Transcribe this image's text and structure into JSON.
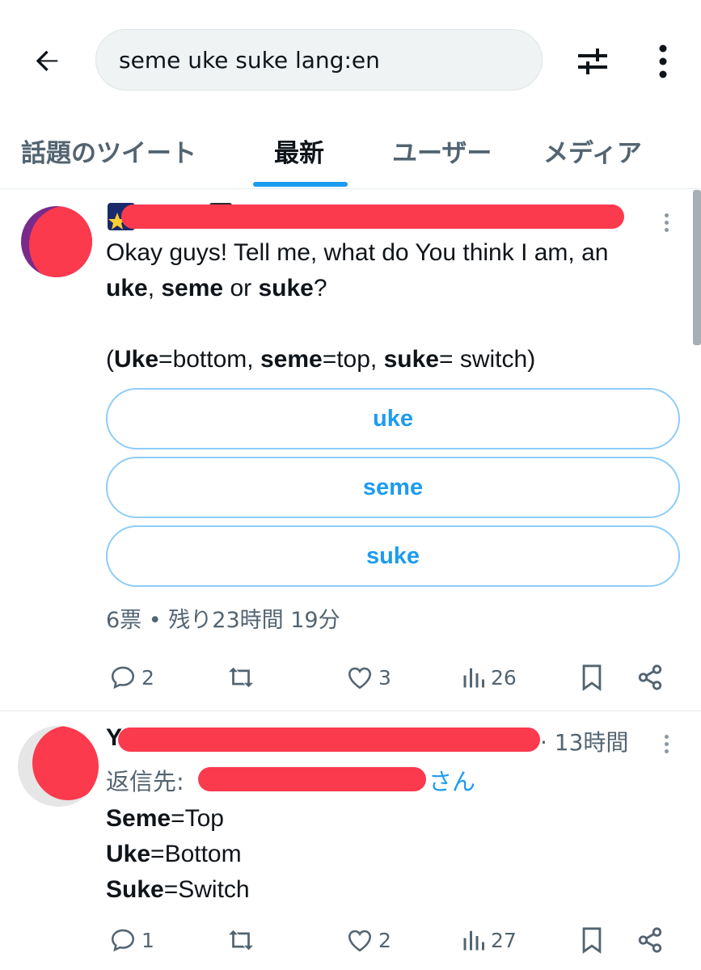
{
  "search": {
    "query": "seme uke suke  lang:en"
  },
  "tabs": [
    {
      "label": "話題のツイート"
    },
    {
      "label": "最新"
    },
    {
      "label": "ユーザー"
    },
    {
      "label": "メディア"
    }
  ],
  "tweet1": {
    "text_line1": "Okay guys! Tell me, what do You think I am, an",
    "line2": [
      {
        "t": "uke",
        "b": true
      },
      {
        "t": ", ",
        "b": false
      },
      {
        "t": "seme",
        "b": true
      },
      {
        "t": " or ",
        "b": false
      },
      {
        "t": "suke",
        "b": true
      },
      {
        "t": "?",
        "b": false
      }
    ],
    "line3": [
      {
        "t": "(",
        "b": false
      },
      {
        "t": "Uke",
        "b": true
      },
      {
        "t": "=bottom, ",
        "b": false
      },
      {
        "t": "seme",
        "b": true
      },
      {
        "t": "=top, ",
        "b": false
      },
      {
        "t": "suke",
        "b": true
      },
      {
        "t": "= switch)",
        "b": false
      }
    ],
    "poll": {
      "options": [
        "uke",
        "seme",
        "suke"
      ],
      "meta": "6票 • 残り23時間 19分"
    },
    "stats": {
      "replies": "2",
      "retweets": "",
      "likes": "3",
      "views": "26"
    }
  },
  "tweet2": {
    "name_fragment": "Y",
    "time": "· 13時間",
    "reply_label": "返信先:",
    "reply_suffix": "さん",
    "lines": [
      [
        {
          "t": "Seme",
          "b": true
        },
        {
          "t": "=Top",
          "b": false
        }
      ],
      [
        {
          "t": "Uke",
          "b": true
        },
        {
          "t": "=Bottom",
          "b": false
        }
      ],
      [
        {
          "t": "Suke",
          "b": true
        },
        {
          "t": "=Switch",
          "b": false
        }
      ]
    ],
    "stats": {
      "replies": "1",
      "retweets": "",
      "likes": "2",
      "views": "27"
    }
  },
  "colors": {
    "accent": "#1d9bf0",
    "redaction": "#fb3a4e",
    "muted": "#536471"
  }
}
